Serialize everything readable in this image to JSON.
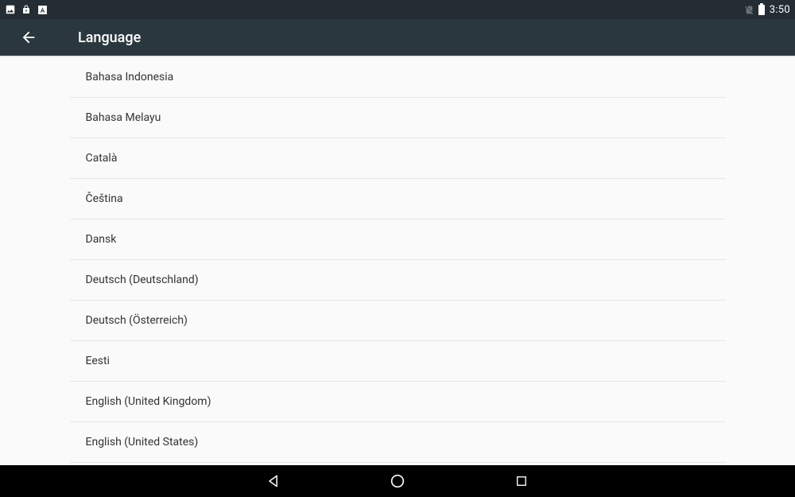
{
  "status": {
    "time": "3:50"
  },
  "header": {
    "title": "Language"
  },
  "languages": [
    "Bahasa Indonesia",
    "Bahasa Melayu",
    "Català",
    "Čeština",
    "Dansk",
    "Deutsch (Deutschland)",
    "Deutsch (Österreich)",
    "Eesti",
    "English (United Kingdom)",
    "English (United States)"
  ]
}
